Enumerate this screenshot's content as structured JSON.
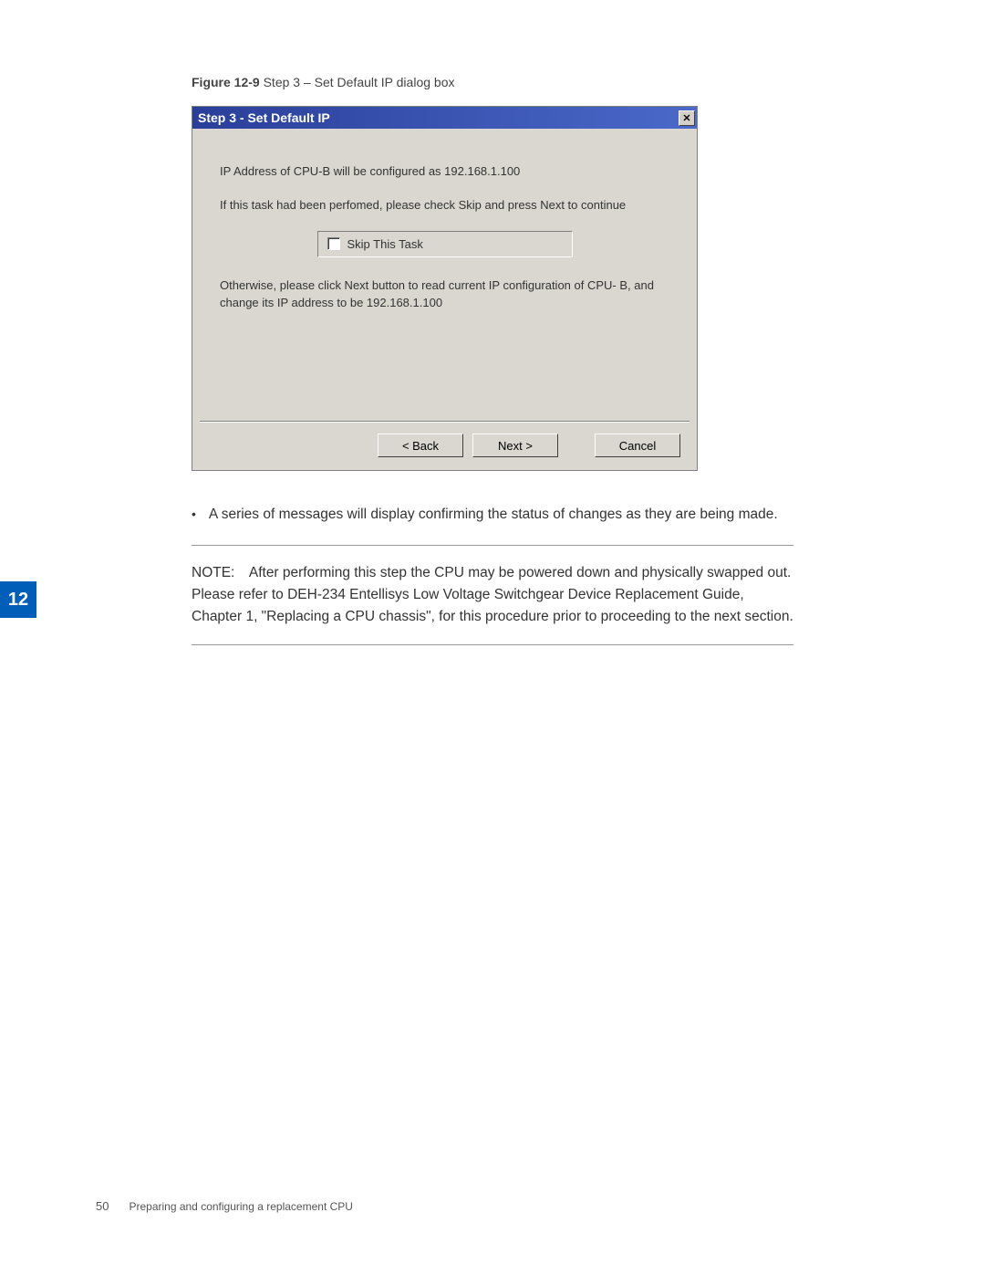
{
  "chapterTab": "12",
  "figureCaption": {
    "label": "Figure 12-9",
    "text": "  Step 3 – Set Default IP dialog box"
  },
  "dialog": {
    "title": "Step 3 - Set Default IP",
    "closeGlyph": "✕",
    "line1": "IP Address of CPU-B will be configured as 192.168.1.100",
    "line2": "If this task had been perfomed, please check Skip and press Next to continue",
    "skipLabel": "Skip This Task",
    "line3": "Otherwise, please click Next button to read current IP configuration of CPU- B, and change its IP address to be 192.168.1.100",
    "buttons": {
      "back": "< Back",
      "next": "Next >",
      "cancel": "Cancel"
    }
  },
  "bullet": "A series of messages will display confirming the status of changes as they are being made.",
  "note": "NOTE: After performing this step the CPU may be powered down and physically swapped out. Please refer to DEH-234 Entellisys Low Voltage Switchgear Device Replacement Guide, Chapter 1, \"Replacing a CPU chassis\", for this procedure prior to proceeding to the next section.",
  "footer": {
    "page": "50",
    "title": "Preparing and configuring a replacement CPU"
  }
}
